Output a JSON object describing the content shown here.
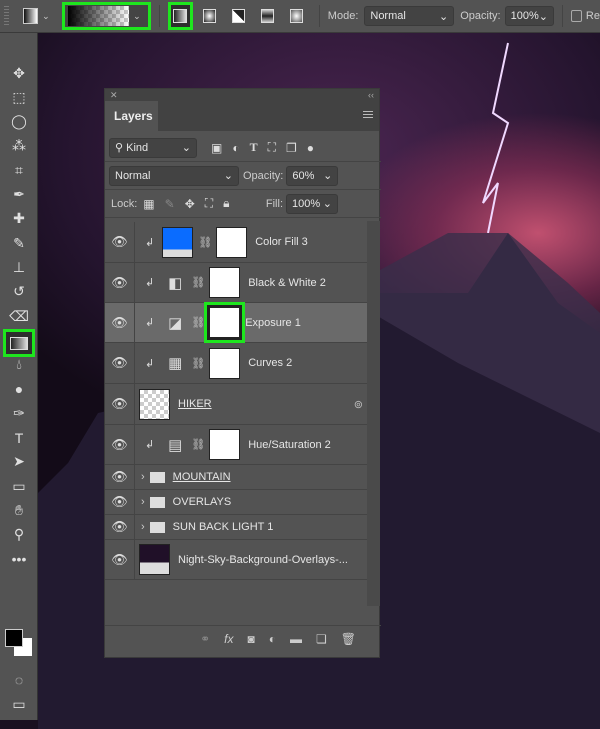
{
  "options_bar": {
    "mode_label": "Mode:",
    "mode_value": "Normal",
    "opacity_label": "Opacity:",
    "opacity_value": "100%",
    "reverse_label": "Re",
    "gradient_types": [
      "linear-gradient-icon",
      "radial-gradient-icon",
      "angle-gradient-icon",
      "reflected-gradient-icon",
      "diamond-gradient-icon"
    ],
    "selected_gradient_type": "linear",
    "highlight_color": "#1ee61e"
  },
  "toolbar": {
    "tools": [
      "move",
      "marquee",
      "lasso",
      "magic-wand",
      "crop",
      "eyedropper",
      "healing-brush",
      "brush",
      "clone-stamp",
      "history-brush",
      "eraser",
      "gradient",
      "blur",
      "dodge",
      "pen",
      "type",
      "path-selection",
      "rectangle",
      "hand",
      "zoom",
      "more"
    ],
    "selected": "gradient",
    "foreground": "#000000",
    "background": "#ffffff"
  },
  "layers_panel": {
    "tab": "Layers",
    "filter_kind": "Kind",
    "blend_mode": "Normal",
    "opacity_label": "Opacity:",
    "opacity_value": "60%",
    "lock_label": "Lock:",
    "fill_label": "Fill:",
    "fill_value": "100%",
    "layers": [
      {
        "name": "Color Fill 3",
        "type": "fill",
        "clipped": true,
        "color": "#0a6cff"
      },
      {
        "name": "Black & White 2",
        "type": "adjustment",
        "clipped": true,
        "icon": "black-white-icon"
      },
      {
        "name": "Exposure 1",
        "type": "adjustment",
        "clipped": true,
        "icon": "exposure-icon",
        "selected": true
      },
      {
        "name": "Curves 2",
        "type": "adjustment",
        "clipped": true,
        "icon": "curves-icon"
      },
      {
        "name": "HIKER",
        "type": "smart",
        "underlined": true
      },
      {
        "name": "Hue/Saturation 2",
        "type": "adjustment",
        "clipped": true,
        "icon": "hue-saturation-icon"
      },
      {
        "name": "MOUNTAIN",
        "type": "group",
        "underlined": true
      },
      {
        "name": "OVERLAYS",
        "type": "group"
      },
      {
        "name": "SUN BACK LIGHT 1",
        "type": "group"
      },
      {
        "name": "Night-Sky-Background-Overlays-...",
        "type": "smart"
      }
    ]
  }
}
